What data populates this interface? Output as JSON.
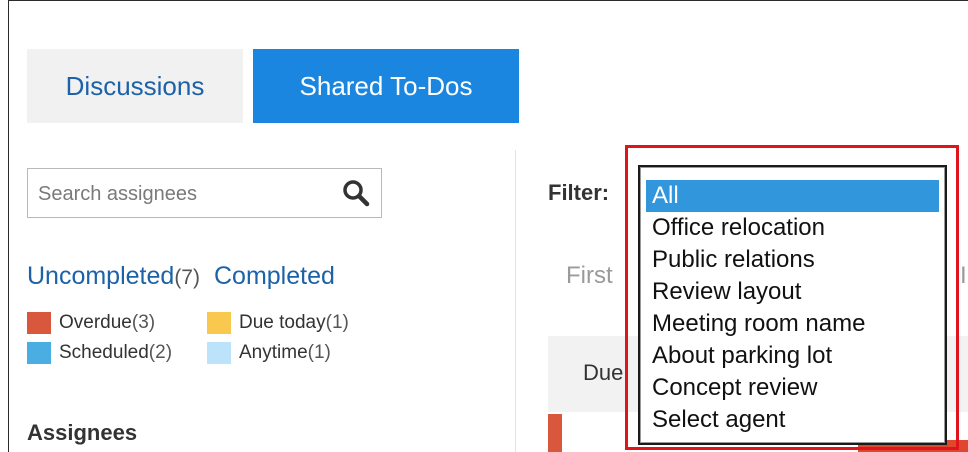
{
  "tabs": [
    {
      "label": "Discussions",
      "active": false
    },
    {
      "label": "Shared To-Dos",
      "active": true
    }
  ],
  "search": {
    "placeholder": "Search assignees",
    "icon": "search-icon"
  },
  "status": {
    "uncompleted_label": "Uncompleted",
    "uncompleted_count": "(7)",
    "completed_label": "Completed"
  },
  "legend": [
    {
      "label": "Overdue",
      "count": "(3)",
      "color": "#d9573c"
    },
    {
      "label": "Due today",
      "count": "(1)",
      "color": "#f8c94e"
    },
    {
      "label": "Scheduled",
      "count": "(2)",
      "color": "#4aaee3"
    },
    {
      "label": "Anytime",
      "count": "(1)",
      "color": "#bde3fa"
    }
  ],
  "assignees_heading": "Assignees",
  "filter": {
    "label": "Filter:",
    "selected": "All",
    "options": [
      "All",
      "Office relocation",
      "Public relations",
      "Review layout",
      "Meeting room name",
      "About parking lot",
      "Concept review",
      "Select agent"
    ]
  },
  "background": {
    "first_text": "First",
    "due_text": "Due",
    "edge_text": "I"
  },
  "colors": {
    "accent": "#1a86df",
    "link": "#1d62a8",
    "highlight": "#e0141b",
    "selected": "#3296dc"
  }
}
